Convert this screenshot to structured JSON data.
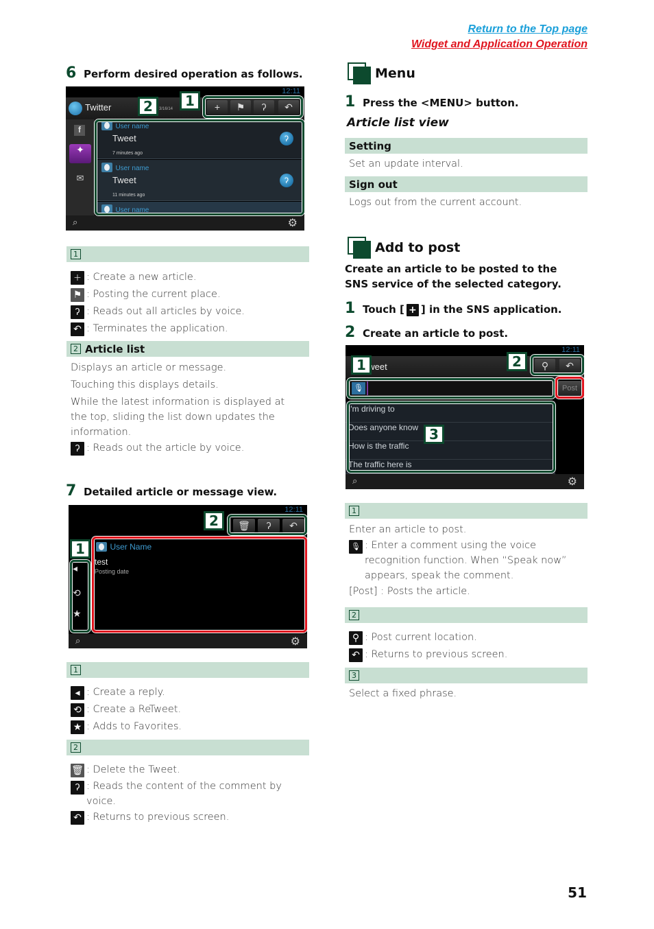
{
  "header": {
    "link_top": "Return to the Top page",
    "link_section": "Widget and Application Operation"
  },
  "left": {
    "step6": {
      "num": "6",
      "text": "Perform desired operation as follows."
    },
    "screen1": {
      "time": "12:11",
      "app_title": "Twitter",
      "header_date": "3/16/14",
      "callouts": [
        "1",
        "2"
      ],
      "tweets": [
        {
          "user": "User name",
          "text": "Tweet",
          "time": "7 minutes ago"
        },
        {
          "user": "User name",
          "text": "Tweet",
          "time": "11 minutes ago"
        },
        {
          "user": "User name",
          "text": "",
          "time": ""
        }
      ]
    },
    "sec1": {
      "band_num": "1",
      "band_title": "",
      "items": [
        {
          "icon": "plus-icon",
          "glyph": "+",
          "text": ": Create a new article."
        },
        {
          "icon": "flag-icon",
          "glyph": "⚑",
          "text": ": Posting the current place."
        },
        {
          "icon": "read-all-voice-icon",
          "glyph": "ʔ",
          "text": ": Reads out all articles by voice."
        },
        {
          "icon": "back-icon",
          "glyph": "↶",
          "text": ": Terminates the application."
        }
      ]
    },
    "sec2": {
      "band_num": "2",
      "band_title": "Article list",
      "lines": [
        "Displays an article or message.",
        "Touching this displays details.",
        "While the latest information is displayed at the top, sliding the list down updates the information."
      ],
      "items": [
        {
          "icon": "voice-read-icon",
          "glyph": "ʔ",
          "text": ": Reads out the article by voice."
        }
      ]
    },
    "step7": {
      "num": "7",
      "text": "Detailed article or message view."
    },
    "screen2": {
      "time": "12:11",
      "user": "User Name",
      "text": "test",
      "date": "Posting date",
      "callouts": [
        "1",
        "2"
      ]
    },
    "sec3": {
      "band_num": "1",
      "items": [
        {
          "icon": "reply-icon",
          "glyph": "◂",
          "text": ": Create a reply."
        },
        {
          "icon": "retweet-icon",
          "glyph": "⟲",
          "text": ": Create a ReTweet."
        },
        {
          "icon": "star-icon",
          "glyph": "★",
          "text": ": Adds to Favorites."
        }
      ]
    },
    "sec4": {
      "band_num": "2",
      "items": [
        {
          "icon": "trash-icon",
          "glyph": "🗑",
          "text": ": Delete the Tweet."
        },
        {
          "icon": "voice-read-icon",
          "glyph": "ʔ",
          "text": ": Reads the content of the comment by voice."
        },
        {
          "icon": "back-icon",
          "glyph": "↶",
          "text": ": Returns to previous screen."
        }
      ]
    }
  },
  "right": {
    "menu": {
      "title": "Menu",
      "step1": {
        "num": "1",
        "text": "Press the <MENU> button."
      },
      "subtitle": "Article list view",
      "options": [
        {
          "label": "Setting",
          "desc": "Set an update interval."
        },
        {
          "label": "Sign out",
          "desc": "Logs out from the current account."
        }
      ]
    },
    "add": {
      "title": "Add to post",
      "intro": "Create an article to be posted to the SNS service of the selected category.",
      "step1": {
        "num": "1",
        "pre": "Touch [",
        "post": "] in the SNS application."
      },
      "step2": {
        "num": "2",
        "text": "Create an article to post."
      }
    },
    "screen3": {
      "time": "12:11",
      "title": "Tweet",
      "post_label": "Post",
      "phrases": [
        "I'm driving to",
        "Does anyone know",
        "How is the traffic",
        "The traffic here is"
      ],
      "callouts": [
        "1",
        "2",
        "3"
      ]
    },
    "sec1": {
      "band_num": "1",
      "line": "Enter an article to post.",
      "items": [
        {
          "icon": "microphone-icon",
          "glyph": "🎙",
          "text": ": Enter a comment using the voice recognition function. When “Speak now” appears, speak the comment."
        }
      ],
      "post_line": "[Post] : Posts the article."
    },
    "sec2": {
      "band_num": "2",
      "items": [
        {
          "icon": "location-pin-icon",
          "glyph": "⚲",
          "text": ": Post current location."
        },
        {
          "icon": "back-icon",
          "glyph": "↶",
          "text": ": Returns to previous screen."
        }
      ]
    },
    "sec3": {
      "band_num": "3",
      "line": "Select a fixed phrase."
    }
  },
  "page_number": "51"
}
